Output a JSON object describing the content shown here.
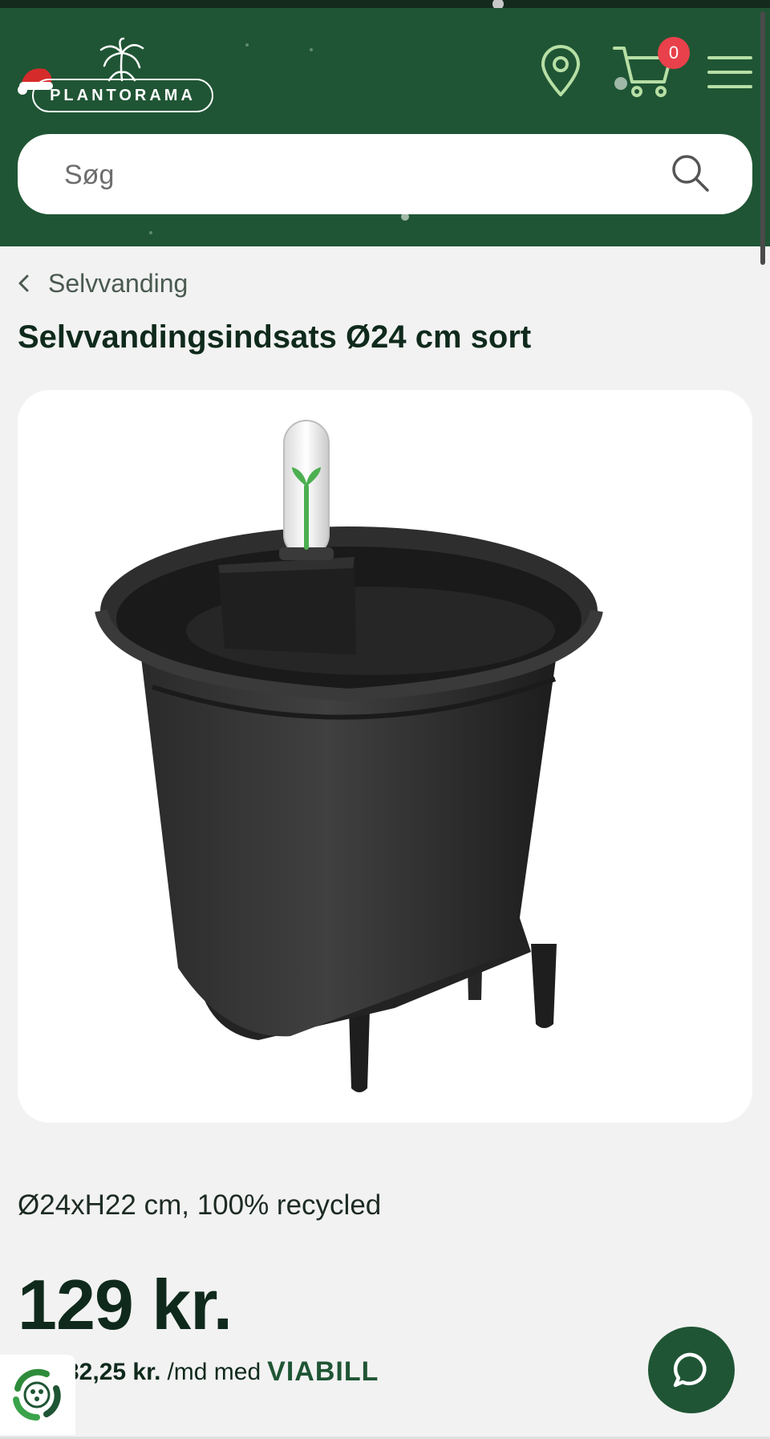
{
  "header": {
    "brand": "PLANTORAMA",
    "cart_count": "0",
    "icons": {
      "location": "location-pin-icon",
      "cart": "shopping-cart-icon",
      "menu": "hamburger-menu-icon",
      "search": "search-icon"
    },
    "colors": {
      "brand_green": "#1f5534",
      "badge_red": "#e8414b"
    }
  },
  "search": {
    "placeholder": "Søg"
  },
  "breadcrumb": {
    "label": "Selvvanding"
  },
  "product": {
    "title": "Selvvandingsindsats Ø24 cm sort",
    "image_alt": "Selvvandingsindsats Ø24 cm sort",
    "subtitle": "Ø24xH22 cm, 100% recycled",
    "price": "129 kr.",
    "finance": {
      "amount": "32,25 kr.",
      "text": "/md med",
      "provider": "VIABILL"
    }
  },
  "widgets": {
    "chat_icon": "chat-bubble-icon",
    "recycle_icon": "recycle-badge-icon"
  }
}
